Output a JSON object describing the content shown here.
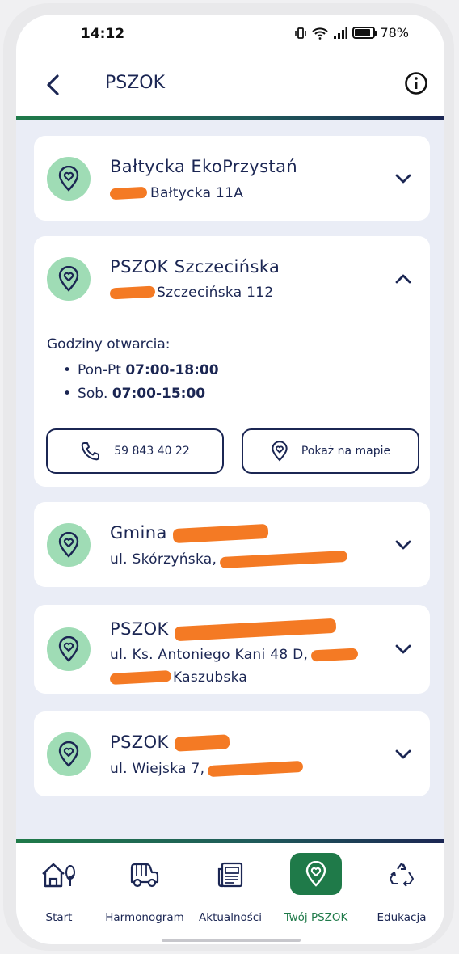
{
  "status": {
    "time": "14:12",
    "battery": "78%"
  },
  "header": {
    "title": "PSZOK"
  },
  "cards": [
    {
      "title": "Bałtycka EkoPrzystań",
      "subtitle": "Bałtycka 11A"
    },
    {
      "title": "PSZOK Szczecińska",
      "subtitle": "Szczecińska 112",
      "hours_title": "Godziny otwarcia:",
      "hours": [
        {
          "label": "Pon-Pt",
          "value": "07:00-18:00"
        },
        {
          "label": "Sob.",
          "value": "07:00-15:00"
        }
      ],
      "phone": "59 843 40 22",
      "map_label": "Pokaż na mapie"
    },
    {
      "title": "Gmina",
      "subtitle": "ul. Skórzyńska,"
    },
    {
      "title": "PSZOK",
      "subtitle": "ul. Ks. Antoniego Kani 48 D,",
      "subtitle2": "Kaszubska"
    },
    {
      "title": "PSZOK",
      "subtitle": "ul. Wiejska 7,"
    }
  ],
  "nav": [
    {
      "label": "Start",
      "icon": "home-tree-icon"
    },
    {
      "label": "Harmonogram",
      "icon": "garbage-truck-icon"
    },
    {
      "label": "Aktualności",
      "icon": "newspaper-icon"
    },
    {
      "label": "Twój PSZOK",
      "icon": "location-heart-icon",
      "active": true
    },
    {
      "label": "Edukacja",
      "icon": "recycle-icon"
    }
  ],
  "colors": {
    "navy": "#1b2653",
    "green": "#1f7a49",
    "pin_bg": "#9fdcb5",
    "redaction": "#f47a24"
  }
}
